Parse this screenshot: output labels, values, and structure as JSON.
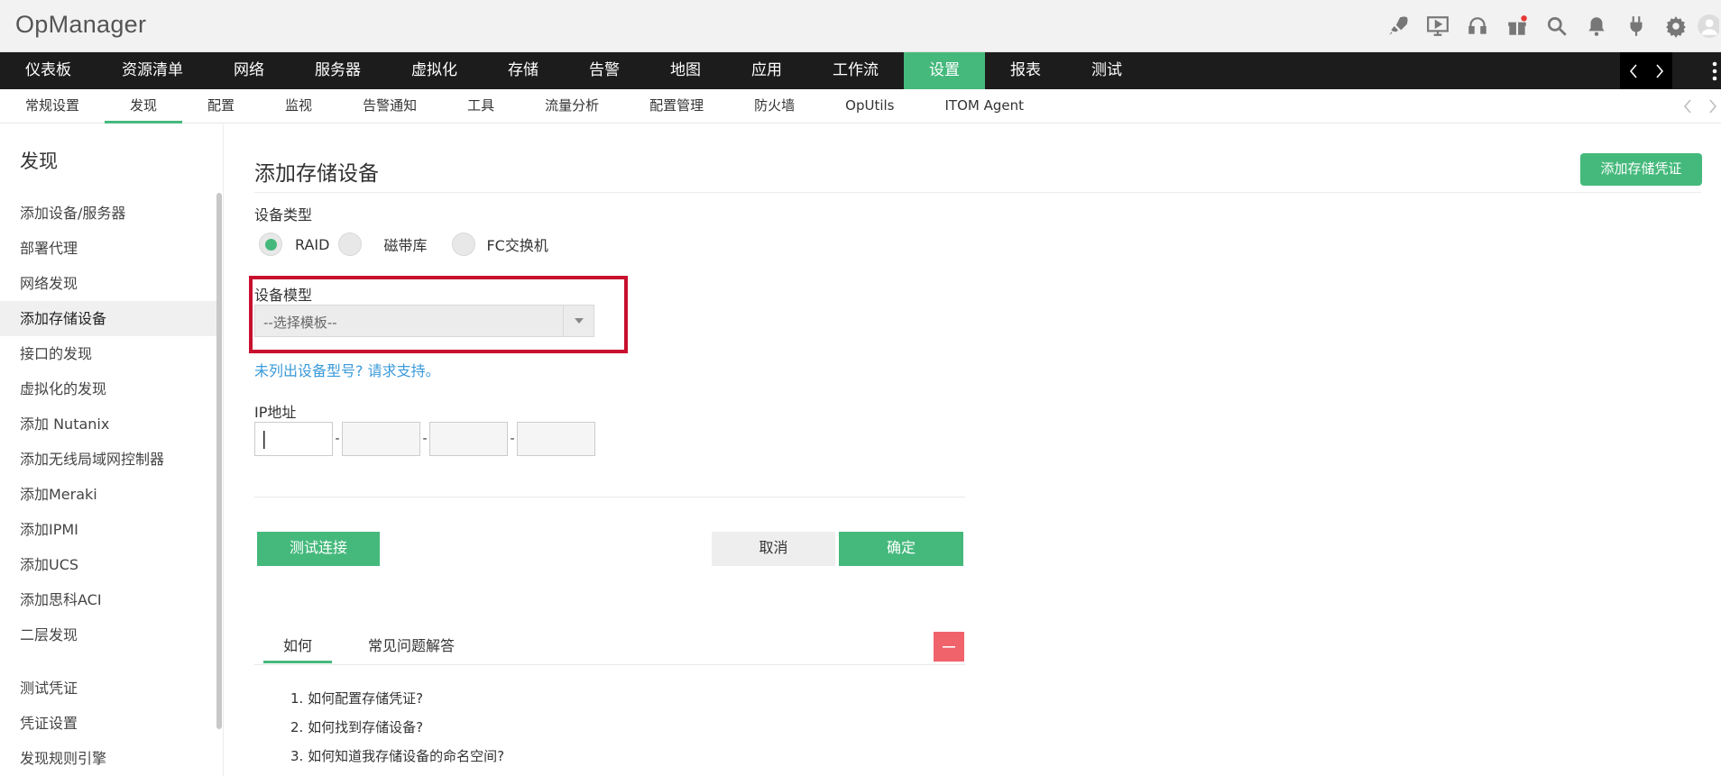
{
  "app": {
    "title": "OpManager"
  },
  "header_icons": [
    "rocket-icon",
    "media-icon",
    "headset-icon",
    "gift-icon",
    "search-icon",
    "bell-icon",
    "plug-icon",
    "gear-icon",
    "user-avatar-icon"
  ],
  "main_nav": {
    "items": [
      "仪表板",
      "资源清单",
      "网络",
      "服务器",
      "虚拟化",
      "存储",
      "告警",
      "地图",
      "应用",
      "工作流",
      "设置",
      "报表",
      "测试"
    ],
    "active": "设置"
  },
  "sub_nav": {
    "items": [
      "常规设置",
      "发现",
      "配置",
      "监视",
      "告警通知",
      "工具",
      "流量分析",
      "配置管理",
      "防火墙",
      "OpUtils",
      "ITOM Agent"
    ],
    "active": "发现"
  },
  "sidebar": {
    "title": "发现",
    "items": [
      "添加设备/服务器",
      "部署代理",
      "网络发现",
      "添加存储设备",
      "接口的发现",
      "虚拟化的发现",
      "添加 Nutanix",
      "添加无线局域网控制器",
      "添加Meraki",
      "添加IPMI",
      "添加UCS",
      "添加思科ACI",
      "二层发现"
    ],
    "active": "添加存储设备",
    "items2": [
      "测试凭证",
      "凭证设置",
      "发现规则引擎"
    ]
  },
  "form": {
    "page_title": "添加存储设备",
    "add_credential_label": "添加存储凭证",
    "device_type_label": "设备类型",
    "device_types": [
      "RAID",
      "磁带库",
      "FC交换机"
    ],
    "selected_device_type": "RAID",
    "device_model_label": "设备模型",
    "device_model_placeholder": "--选择模板--",
    "support_link": "未列出设备型号? 请求支持。",
    "ip_label": "IP地址",
    "ip_separator": "-",
    "test_button": "测试连接",
    "cancel_button": "取消",
    "ok_button": "确定"
  },
  "help": {
    "tabs": [
      "如何",
      "常见问题解答"
    ],
    "active_tab": "如何",
    "faq": [
      "1. 如何配置存储凭证?",
      "2. 如何找到存储设备?",
      "3. 如何知道我存储设备的命名空间?"
    ]
  },
  "colors": {
    "accent": "#45b97c",
    "nav_bg": "#1c1c1c",
    "highlight": "#c8102e",
    "link": "#3a9ad9",
    "collapse": "#f0636b"
  }
}
